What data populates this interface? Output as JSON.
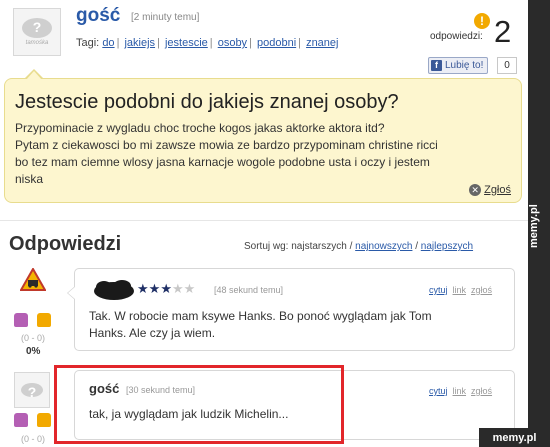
{
  "question": {
    "user": "gość",
    "time": "[2 minuty temu]",
    "tags_label": "Tagi:",
    "tags": [
      "do",
      "jakiejs",
      "jestescie",
      "osoby",
      "podobni",
      "znanej"
    ],
    "answers_label": "odpowiedzi:",
    "answers_badge": "!",
    "answers_count": "2",
    "like_label": "Lubię to!",
    "like_count": "0",
    "title": "Jestescie podobni do jakiejs znanej osoby?",
    "body_lines": [
      "Przypominacie z wygladu choc troche kogos jakas aktorke aktora itd?",
      "Pytam z ciekawosci bo mi zawsze mowia ze bardzo przypominam christine ricci",
      "bo tez mam ciemne wlosy jasna karnacje wogole podobne usta i oczy i jestem",
      "niska"
    ],
    "report_label": "Zgłoś",
    "avatar_caption": "tamośka"
  },
  "answers_section": {
    "title": "Odpowiedzi",
    "sort_label": "Sortuj wg:",
    "sort_current": "najstarszych",
    "sort_options": [
      "najnowszych",
      "najlepszych"
    ]
  },
  "answers": [
    {
      "time": "[48 sekund temu]",
      "rating": 2.5,
      "text_lines": [
        "Tak. W robocie mam ksywe Hanks. Bo ponoć wyglądam jak Tom",
        "Hanks. Ale czy ja wiem."
      ],
      "actions": [
        "cytuj",
        "link",
        "zgłoś"
      ],
      "votes": "(0 - 0)",
      "percent": "0%"
    },
    {
      "user": "gość",
      "time": "[30 sekund temu]",
      "text": "tak, ja wyglądam jak ludzik Michelin...",
      "actions": [
        "cytuj",
        "link",
        "zgłoś"
      ],
      "votes": "(0 - 0)"
    }
  ],
  "watermark": {
    "side": "memy.pl",
    "corner": "memy.pl"
  },
  "colors": {
    "link": "#2a5aa8",
    "question_bg": "#fdf6cf",
    "highlight": "#e2262a",
    "badge": "#f2a900"
  }
}
